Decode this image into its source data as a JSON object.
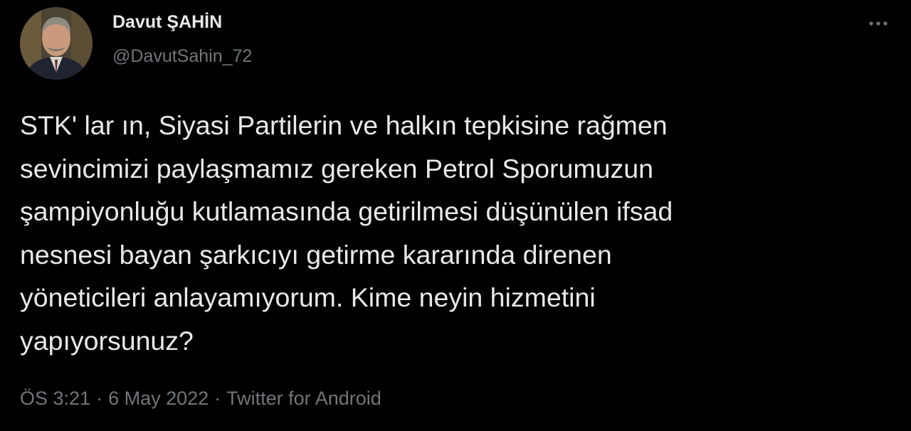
{
  "tweet": {
    "author": {
      "display_name": "Davut ŞAHİN",
      "handle": "@DavutSahin_72"
    },
    "text": "STK' lar ın, Siyasi Partilerin ve halkın tepkisine rağmen\nsevincimizi paylaşmamız gereken Petrol Sporumuzun\nşampiyonluğu kutlamasında getirilmesi düşünülen ifsad\nnesnesi bayan şarkıcıyı getirme kararında direnen\nyöneticileri anlayamıyorum. Kime neyin hizmetini\nyapıyorsunuz?",
    "time": "ÖS 3:21",
    "date": "6 May 2022",
    "separator": "·",
    "source": "Twitter for Android",
    "more_icon": "more-horizontal-icon"
  },
  "colors": {
    "background": "#000000",
    "primary_text": "#e7e9ea",
    "secondary_text": "#71767b"
  }
}
